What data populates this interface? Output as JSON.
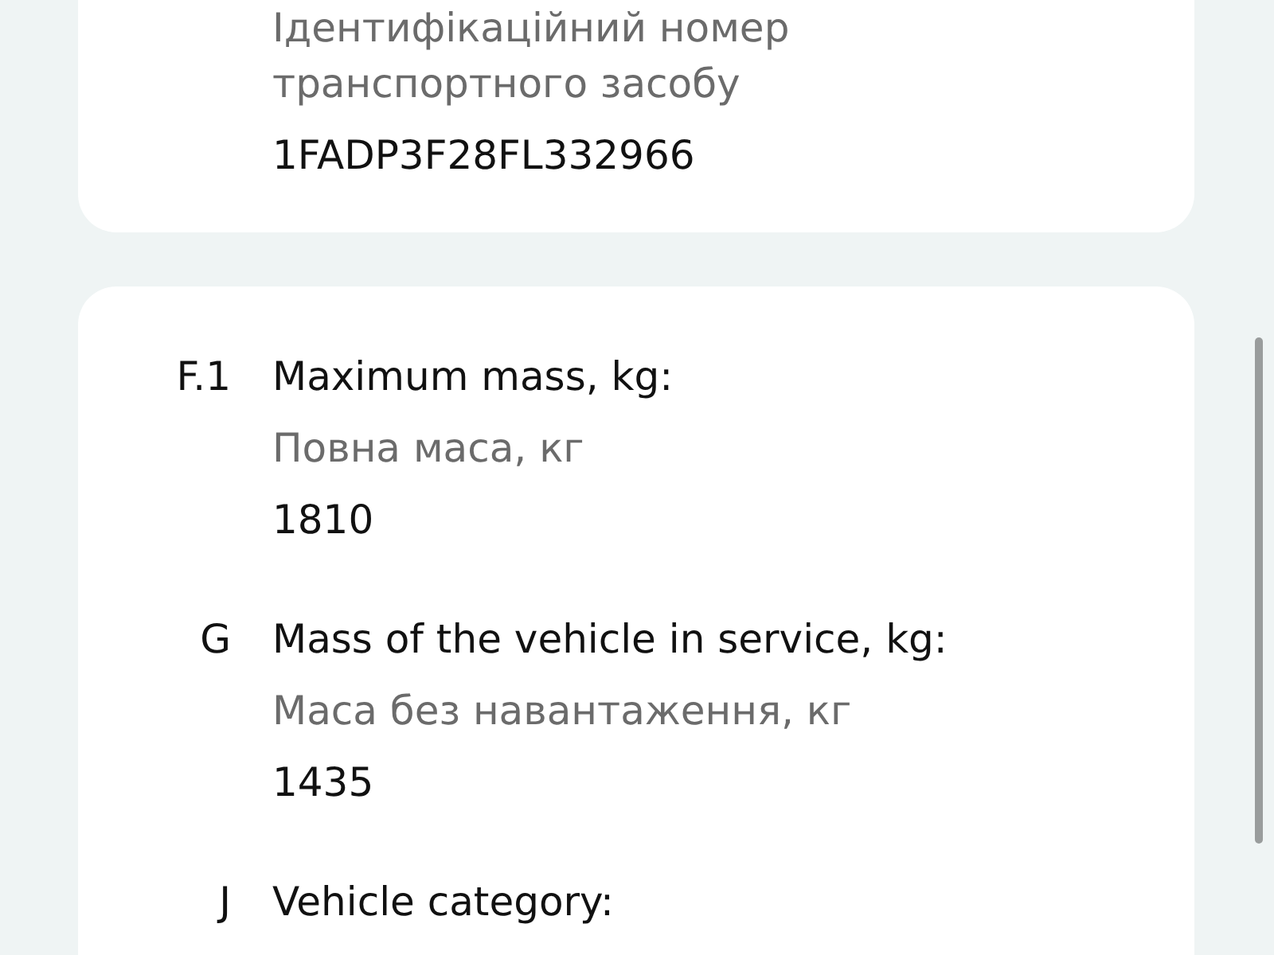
{
  "cards": [
    {
      "fields": [
        {
          "translation": "Ідентифікаційний номер транспортного засобу",
          "value": "1FADP3F28FL332966"
        }
      ]
    },
    {
      "fields": [
        {
          "code": "F.1",
          "label": "Maximum mass, kg:",
          "translation": "Повна маса, кг",
          "value": "1810"
        },
        {
          "code": "G",
          "label": "Mass of the vehicle in service, kg:",
          "translation": "Маса без навантаження, кг",
          "value": "1435"
        },
        {
          "code": "J",
          "label": "Vehicle category:"
        }
      ]
    }
  ]
}
